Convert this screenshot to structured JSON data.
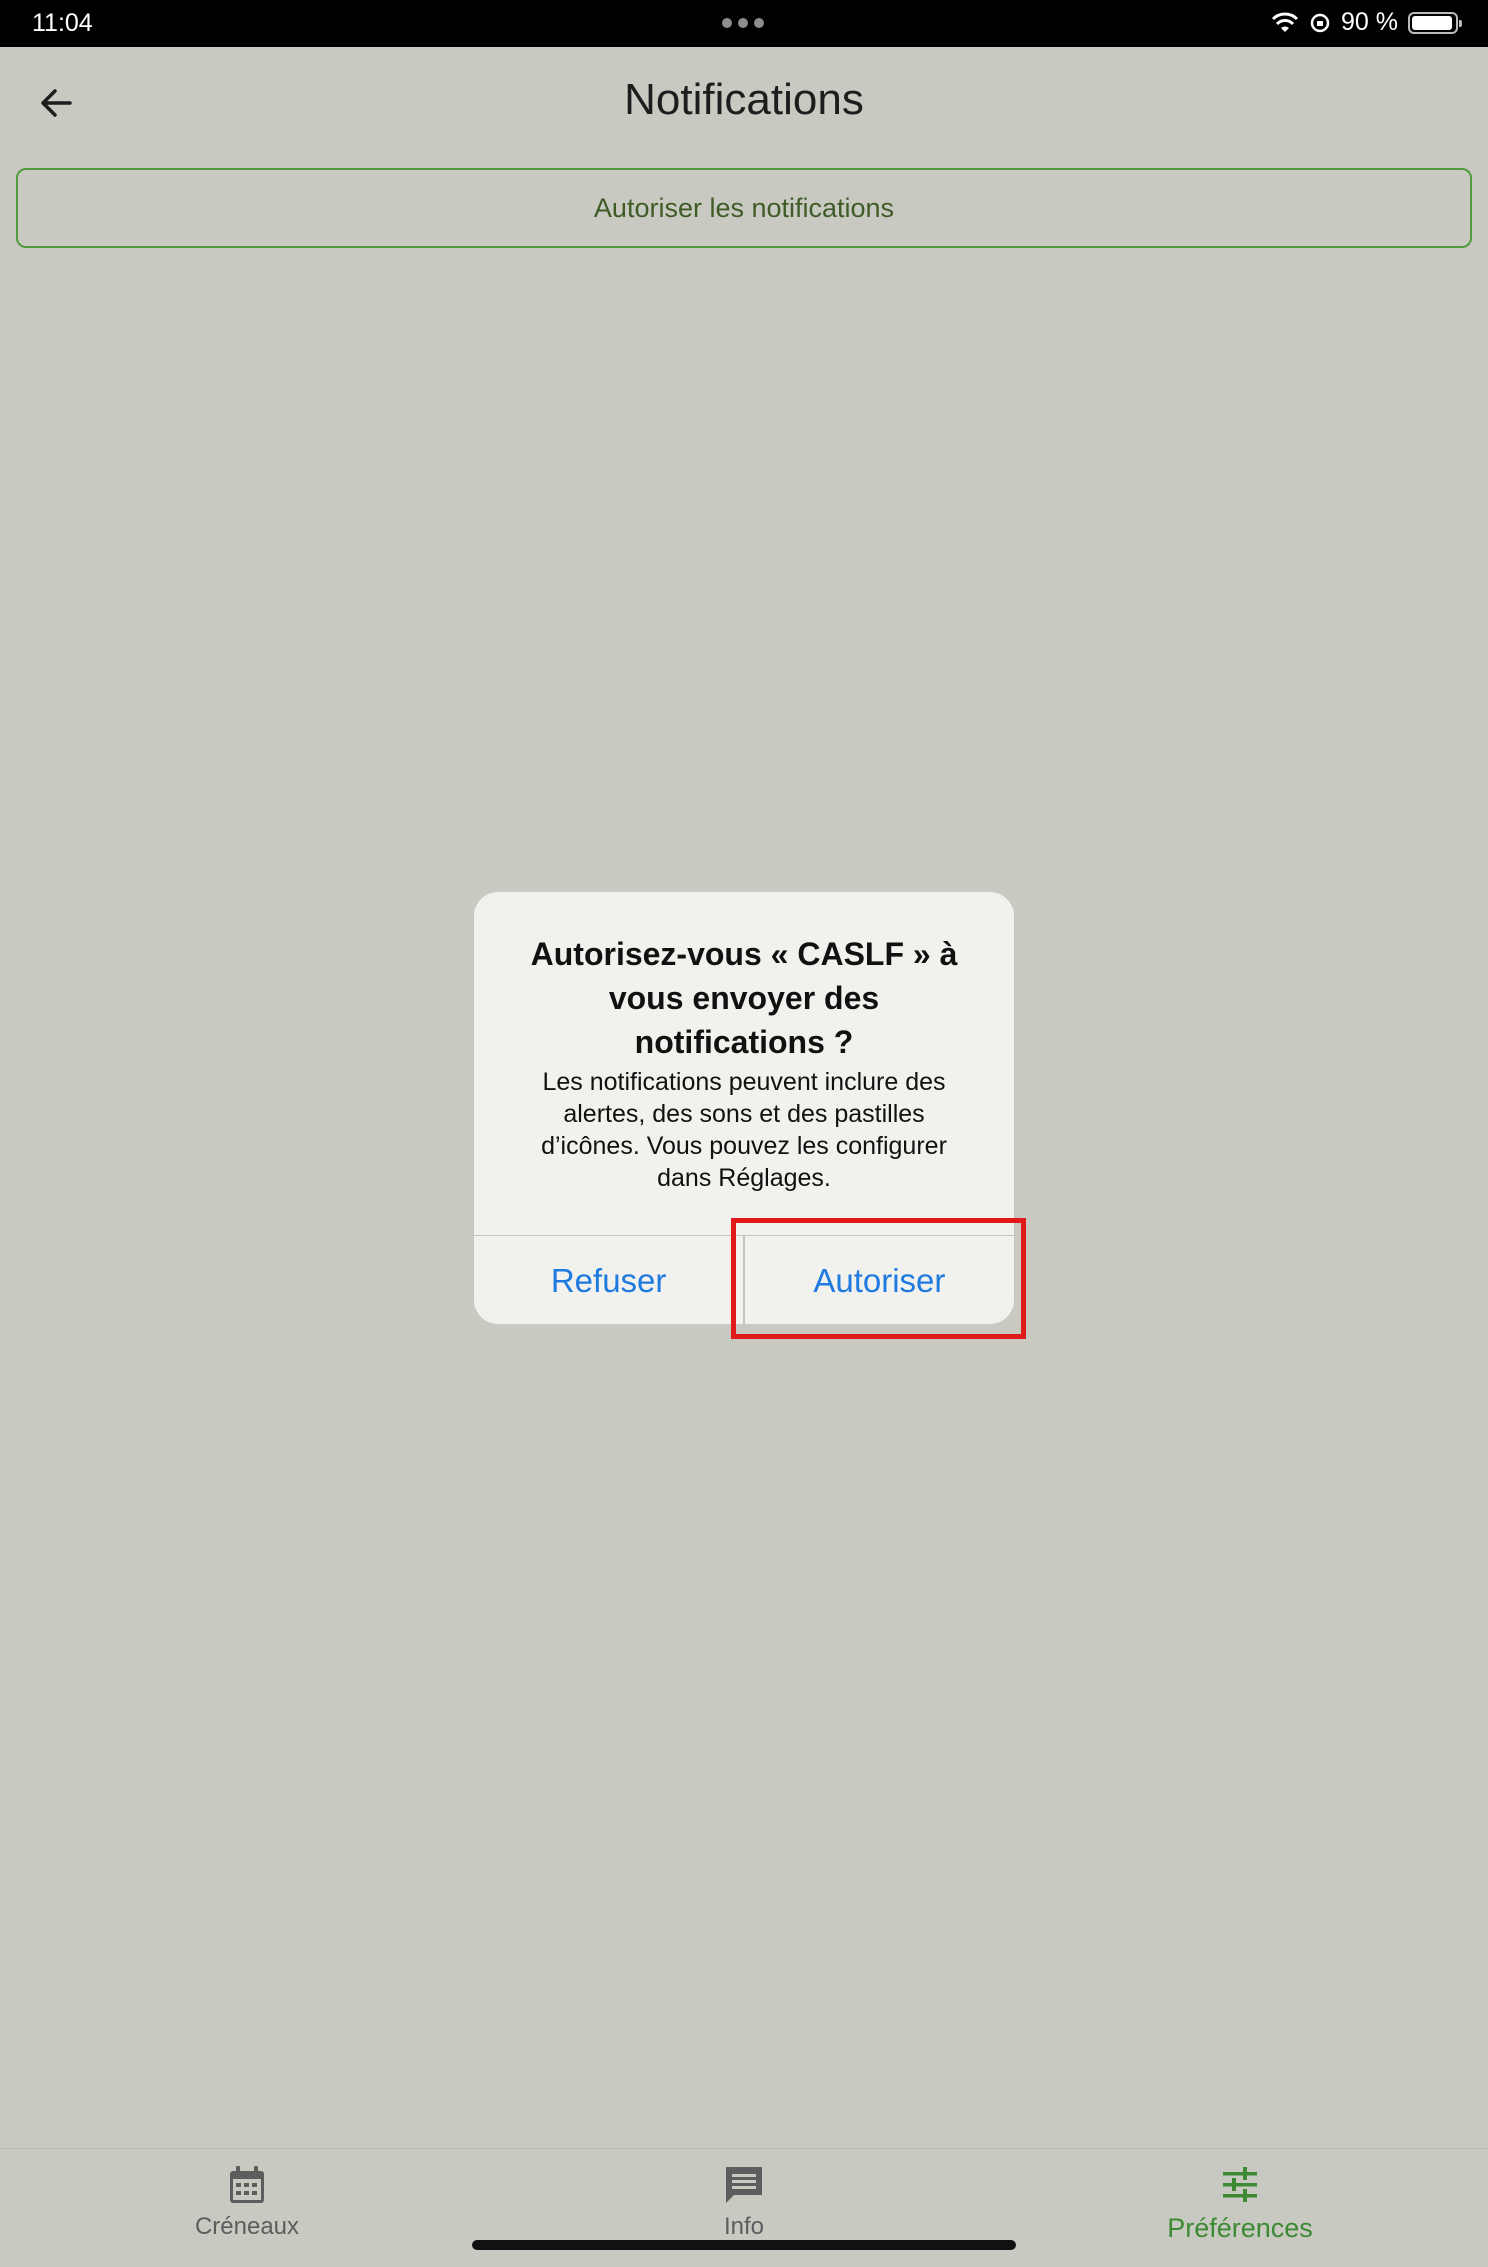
{
  "status_bar": {
    "time": "11:04",
    "battery_text": "90 %",
    "battery_level": 0.9
  },
  "header": {
    "title": "Notifications",
    "back_icon": "arrow-left-icon"
  },
  "allow_button": {
    "label": "Autoriser les notifications"
  },
  "dialog": {
    "title": "Autorisez-vous « CASLF » à vous envoyer des notifications ?",
    "body": "Les notifications peuvent inclure des alertes, des sons et des pastilles d’icônes. Vous pouvez les configurer dans Réglages.",
    "refuse_label": "Refuser",
    "allow_label": "Autoriser"
  },
  "bottom_nav": {
    "items": [
      {
        "label": "Créneaux",
        "icon": "calendar-icon",
        "active": false
      },
      {
        "label": "Info",
        "icon": "message-icon",
        "active": false
      },
      {
        "label": "Préférences",
        "icon": "sliders-icon",
        "active": true
      }
    ]
  },
  "colors": {
    "background": "#c8c9c1",
    "accent_green": "#3d8a34",
    "dialog_button": "#1f7ae0",
    "highlight": "#e01a1a"
  }
}
